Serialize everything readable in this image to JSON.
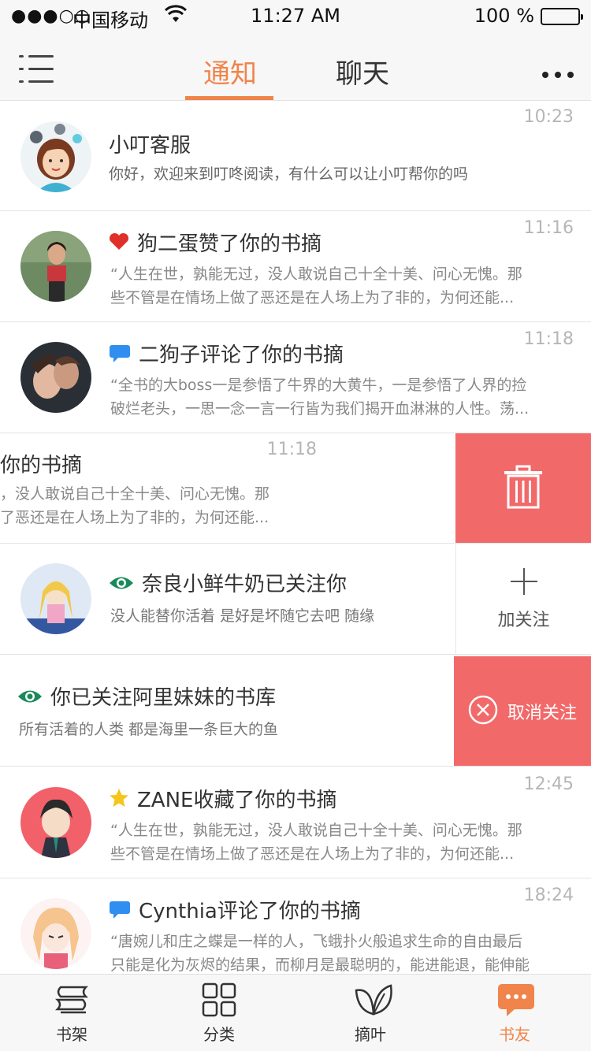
{
  "status_bar": {
    "signal": "●●●○○",
    "carrier": "中国移动",
    "time": "11:27 AM",
    "battery": "100 %"
  },
  "nav": {
    "tabs": [
      "通知",
      "聊天"
    ],
    "active_tab": "通知"
  },
  "colors": {
    "accent": "#f0844a",
    "delete_red": "#f2696a",
    "heart": "#e0302a",
    "comment": "#2f8ef0",
    "eye": "#1a8a5a",
    "star": "#f5c518"
  },
  "notifications": [
    {
      "type": "service",
      "title": "小叮客服",
      "desc": "你好，欢迎来到叮咚阅读，有什么可以让小叮帮你的吗",
      "time": "10:23"
    },
    {
      "type": "like",
      "icon": "heart-icon",
      "title": "狗二蛋赞了你的书摘",
      "line1": "“人生在世，孰能无过，没人敢说自己十全十美、问心无愧。那",
      "line2": "些不管是在情场上做了恶还是在人场上为了非的，为何还能...",
      "time": "11:16"
    },
    {
      "type": "comment",
      "icon": "comment-icon",
      "title": "二狗子评论了你的书摘",
      "line1": "“全书的大boss一是参悟了牛界的大黄牛，一是参悟了人界的捡",
      "line2": "破烂老头，一思一念一言一行皆为我们揭开血淋淋的人性。荡...",
      "time": "11:18"
    },
    {
      "type": "like-swiped",
      "title": "你的书摘",
      "line1": "，没人敢说自己十全十美、问心无愧。那",
      "line2": "了恶还是在人场上为了非的，为何还能...",
      "time": "11:18",
      "action": "delete"
    },
    {
      "type": "follow",
      "icon": "eye-icon",
      "title": "奈良小鲜牛奶已关注你",
      "desc": "没人能替你活着 是好是坏随它去吧 随缘",
      "action": "加关注"
    },
    {
      "type": "followed-swiped",
      "icon": "eye-icon",
      "title": "你已关注阿里妹妹的书库",
      "desc": "所有活着的人类 都是海里一条巨大的鱼",
      "action": "取消关注"
    },
    {
      "type": "collect",
      "icon": "star-icon",
      "title": "ZANE收藏了你的书摘",
      "line1": "“人生在世，孰能无过，没人敢说自己十全十美、问心无愧。那",
      "line2": "些不管是在情场上做了恶还是在人场上为了非的，为何还能...",
      "time": "12:45"
    },
    {
      "type": "comment",
      "icon": "comment-icon",
      "title": "Cynthia评论了你的书摘",
      "line1": "“唐婉儿和庄之蝶是一样的人，飞蛾扑火般追求生命的自由最后",
      "line2": "只能是化为灰烬的结果，而柳月是最聪明的，能进能退，能伸能",
      "time": "18:24"
    }
  ],
  "tab_bar": {
    "items": [
      "书架",
      "分类",
      "摘叶",
      "书友"
    ],
    "active": "书友"
  }
}
